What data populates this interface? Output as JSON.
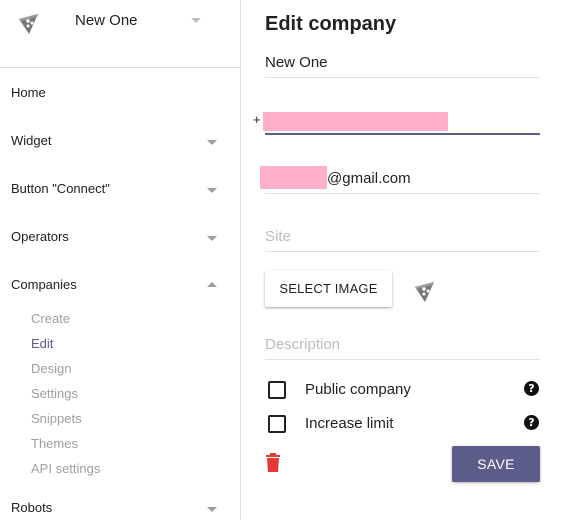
{
  "brand": {
    "name": "New One",
    "logo_icon": "pizza-slice-icon"
  },
  "nav": {
    "home": "Home",
    "widget": "Widget",
    "button_connect": "Button \"Connect\"",
    "operators": "Operators",
    "companies": "Companies",
    "companies_sub": [
      "Create",
      "Edit",
      "Design",
      "Settings",
      "Snippets",
      "Themes",
      "API settings"
    ],
    "robots": "Robots"
  },
  "form": {
    "title": "Edit company",
    "name_value": "New One",
    "phone_prefix": "+",
    "email_suffix": "@gmail.com",
    "site_placeholder": "Site",
    "select_image_label": "SELECT IMAGE",
    "description_placeholder": "Description",
    "public_company_label": "Public company",
    "increase_limit_label": "Increase limit",
    "help_glyph": "?",
    "save_label": "SAVE"
  },
  "colors": {
    "accent": "#5c5c8a",
    "danger": "#e53935",
    "redaction": "#ffb0cc"
  }
}
